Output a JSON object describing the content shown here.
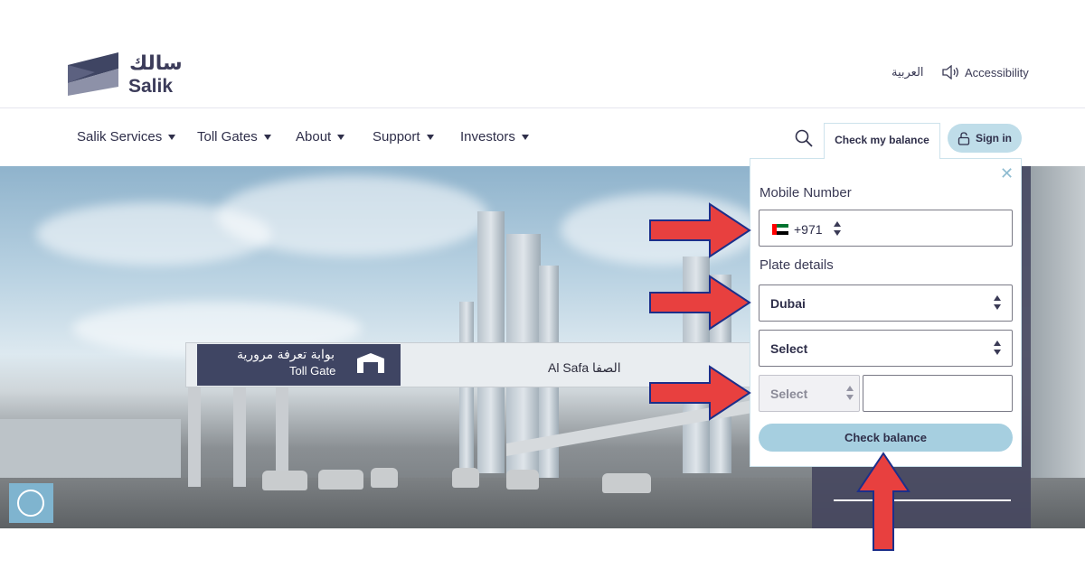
{
  "header": {
    "logo_arabic": "سالك",
    "logo_english": "Salik",
    "language_link": "العربية",
    "accessibility_label": "Accessibility"
  },
  "nav": {
    "items": [
      {
        "label": "Salik Services"
      },
      {
        "label": "Toll Gates"
      },
      {
        "label": "About"
      },
      {
        "label": "Support"
      },
      {
        "label": "Investors"
      }
    ],
    "check_balance_tab": "Check my balance",
    "sign_in_label": "Sign in"
  },
  "hero": {
    "gantry_arabic": "بوابة تعرفة مرورية",
    "gantry_english": "Toll Gate",
    "gantry_location": "Al Safa الصفا"
  },
  "balance_form": {
    "mobile_label": "Mobile Number",
    "country_code": "+971",
    "mobile_value": "",
    "plate_label": "Plate details",
    "emirate_value": "Dubai",
    "plate_source_value": "Select",
    "plate_code_value": "Select",
    "plate_number_value": "",
    "submit_label": "Check balance"
  },
  "colors": {
    "brand_navy": "#3f4563",
    "accent_light_blue": "#a6cfe0",
    "annotation_red": "#e8403f"
  }
}
